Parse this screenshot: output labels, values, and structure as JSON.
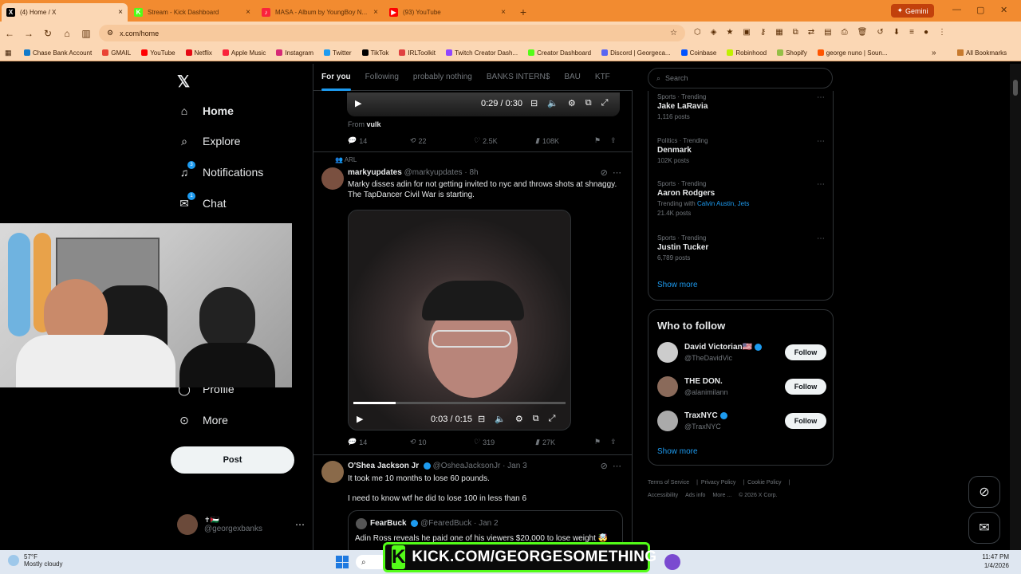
{
  "browser": {
    "tabs": [
      {
        "title": "(4) Home / X",
        "icon": "x-icon",
        "color": "#000000",
        "letter": "X"
      },
      {
        "title": "Stream - Kick Dashboard",
        "icon": "kick-icon",
        "color": "#53fc18",
        "letter": "K"
      },
      {
        "title": "MASA - Album by YoungBoy N...",
        "icon": "apple-music-icon",
        "color": "#fa233b",
        "letter": "♪"
      },
      {
        "title": "(93) YouTube",
        "icon": "youtube-icon",
        "color": "#ff0000",
        "letter": "▶"
      }
    ],
    "gemini_label": "Gemini",
    "url": "x.com/home",
    "bookmarks": [
      {
        "label": "Chase Bank Account",
        "color": "#117aca"
      },
      {
        "label": "GMAIL",
        "color": "#ea4335"
      },
      {
        "label": "YouTube",
        "color": "#ff0000"
      },
      {
        "label": "Netflix",
        "color": "#e50914"
      },
      {
        "label": "Apple Music",
        "color": "#fa233b"
      },
      {
        "label": "Instagram",
        "color": "#d62976"
      },
      {
        "label": "Twitter",
        "color": "#1d9bf0"
      },
      {
        "label": "TikTok",
        "color": "#000000"
      },
      {
        "label": "IRLToolkit",
        "color": "#e04040"
      },
      {
        "label": "Twitch Creator Dash...",
        "color": "#9146ff"
      },
      {
        "label": "Creator Dashboard",
        "color": "#53fc18"
      },
      {
        "label": "Discord | Georgeca...",
        "color": "#5865f2"
      },
      {
        "label": "Coinbase",
        "color": "#0052ff"
      },
      {
        "label": "Robinhood",
        "color": "#c0f000"
      },
      {
        "label": "Shopify",
        "color": "#95bf47"
      },
      {
        "label": "george nuno | Soun...",
        "color": "#ff5500"
      }
    ],
    "all_bookmarks": "All Bookmarks"
  },
  "leftnav": {
    "items": [
      {
        "label": "Home",
        "icon": "home-icon",
        "glyph": "⌂",
        "badge": ""
      },
      {
        "label": "Explore",
        "icon": "search-icon",
        "glyph": "⌕",
        "badge": ""
      },
      {
        "label": "Notifications",
        "icon": "bell-icon",
        "glyph": "🔔",
        "badge": "3"
      },
      {
        "label": "Chat",
        "icon": "mail-icon",
        "glyph": "✉",
        "badge": "1"
      },
      {
        "label": "Profile",
        "icon": "person-icon",
        "glyph": "👤",
        "badge": ""
      },
      {
        "label": "More",
        "icon": "more-icon",
        "glyph": "⋯",
        "badge": ""
      }
    ],
    "post_label": "Post",
    "account": {
      "name": "✝🇵🇸",
      "handle": "@georgexbanks"
    }
  },
  "feed": {
    "tabs": [
      "For you",
      "Following",
      "probably nothing",
      "BANKS INTERN$",
      "BAU",
      "KTF"
    ],
    "video1": {
      "time": "0:29 / 0:30"
    },
    "from_label": "From",
    "from_name": "vulk",
    "actions1": {
      "replies": "14",
      "reposts": "22",
      "likes": "2.5K",
      "views": "108K"
    },
    "tweet1": {
      "context": "ARL",
      "name": "markyupdates",
      "handle": "@markyupdates",
      "time": "· 8h",
      "text": "Marky disses adin for not getting invited to nyc and throws shots at shnaggy. The TapDancer Civil War is starting.",
      "video_time": "0:03 / 0:15",
      "video_progress": 0.2,
      "actions": {
        "replies": "14",
        "reposts": "10",
        "likes": "319",
        "views": "27K"
      }
    },
    "tweet2": {
      "name": "O'Shea Jackson Jr",
      "handle": "@OsheaJacksonJr",
      "time": "· Jan 3",
      "text1": "It took me 10 months to lose 60 pounds.",
      "text2": "I need to know wtf he did to lose 100 in less than 6",
      "quote": {
        "name": "FearBuck",
        "handle": "@FearedBuck",
        "time": "· Jan 2",
        "text": "Adin Ross reveals he paid one of his viewers $20,000 to lose weight 🤯"
      }
    }
  },
  "right": {
    "search_placeholder": "Search",
    "trends": [
      {
        "category": "Sports · Trending",
        "name": "Jake LaRavia",
        "count": "1,116 posts",
        "with": ""
      },
      {
        "category": "Politics · Trending",
        "name": "Denmark",
        "count": "102K posts",
        "with": ""
      },
      {
        "category": "Sports · Trending",
        "name": "Aaron Rodgers",
        "count": "21.4K posts",
        "with_label": "Trending with",
        "with": "Calvin Austin, Jets"
      },
      {
        "category": "Sports · Trending",
        "name": "Justin Tucker",
        "count": "6,789 posts",
        "with": ""
      }
    ],
    "show_more": "Show more",
    "who_to_follow": "Who to follow",
    "follow": [
      {
        "name": "David Victorian🇺🇸",
        "handle": "@TheDavidVic",
        "verified": true
      },
      {
        "name": "THE DON.",
        "handle": "@alanimilann",
        "verified": false
      },
      {
        "name": "TraxNYC",
        "handle": "@TraxNYC",
        "verified": true
      }
    ],
    "follow_label": "Follow",
    "footer": [
      "Terms of Service",
      "Privacy Policy",
      "Cookie Policy",
      "Accessibility",
      "Ads info",
      "More ...",
      "© 2026 X Corp."
    ]
  },
  "taskbar": {
    "temp": "57°F",
    "weather": "Mostly cloudy",
    "time": "11:47 PM",
    "date": "1/4/2026"
  },
  "overlay": {
    "kick_text": "KICK.COM/GEORGESOMETHING"
  }
}
